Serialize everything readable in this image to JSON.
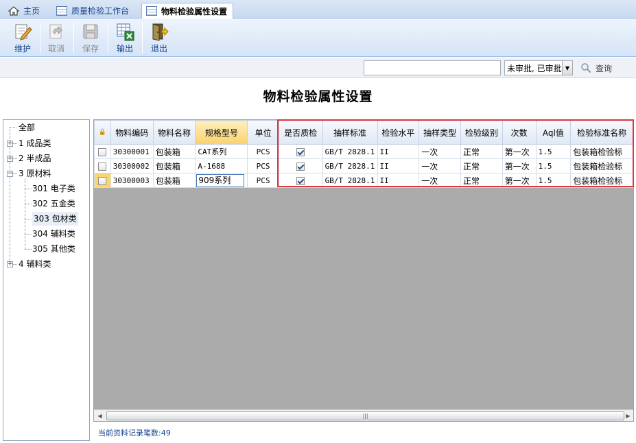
{
  "tabs": [
    {
      "label": "主页",
      "icon": "home-icon"
    },
    {
      "label": "质量检验工作台",
      "icon": "grid-icon"
    },
    {
      "label": "物料检验属性设置",
      "icon": "grid-icon",
      "active": true
    }
  ],
  "toolbar": {
    "maintain_label": "维护",
    "cancel_label": "取消",
    "save_label": "保存",
    "export_label": "输出",
    "exit_label": "退出"
  },
  "search": {
    "value": "",
    "placeholder": "",
    "status_value": "未审批, 已审批",
    "query_label": "查询"
  },
  "page": {
    "title": "物料检验属性设置"
  },
  "tree": {
    "root": "全部",
    "items": [
      {
        "label": "1 成品类"
      },
      {
        "label": "2 半成品"
      },
      {
        "label": "3 原材料",
        "children": [
          "301 电子类",
          "302 五金类",
          "303 包材类",
          "304 辅料类",
          "305 其他类"
        ]
      },
      {
        "label": "4 辅料类"
      }
    ]
  },
  "grid": {
    "lock_symbol": "🔒",
    "columns": [
      "物料编码",
      "物料名称",
      "规格型号",
      "单位",
      "是否质检",
      "抽样标准",
      "检验水平",
      "抽样类型",
      "检验级别",
      "次数",
      "Aql值",
      "检验标准名称"
    ],
    "rows": [
      {
        "code": "30300001",
        "name": "包装箱",
        "spec": "CAT系列",
        "unit": "PCS",
        "qc": true,
        "standard": "GB/T 2828.1",
        "level": "II",
        "sample_type": "一次",
        "grade": "正常",
        "times": "第一次",
        "aql": "1.5",
        "std_name": "包装箱检验标"
      },
      {
        "code": "30300002",
        "name": "包装箱",
        "spec": "A-1688",
        "unit": "PCS",
        "qc": true,
        "standard": "GB/T 2828.1",
        "level": "II",
        "sample_type": "一次",
        "grade": "正常",
        "times": "第一次",
        "aql": "1.5",
        "std_name": "包装箱检验标"
      },
      {
        "code": "30300003",
        "name": "包装箱",
        "spec": "909系列",
        "unit": "PCS",
        "qc": true,
        "standard": "GB/T 2828.1",
        "level": "II",
        "sample_type": "一次",
        "grade": "正常",
        "times": "第一次",
        "aql": "1.5",
        "std_name": "包装箱检验标"
      }
    ]
  },
  "footer": {
    "record_count": "当前资料记录笔数:49"
  },
  "colors": {
    "accent": "#15428b",
    "highlight_header": "#f9d16d",
    "annotation_red": "#d9363e"
  }
}
